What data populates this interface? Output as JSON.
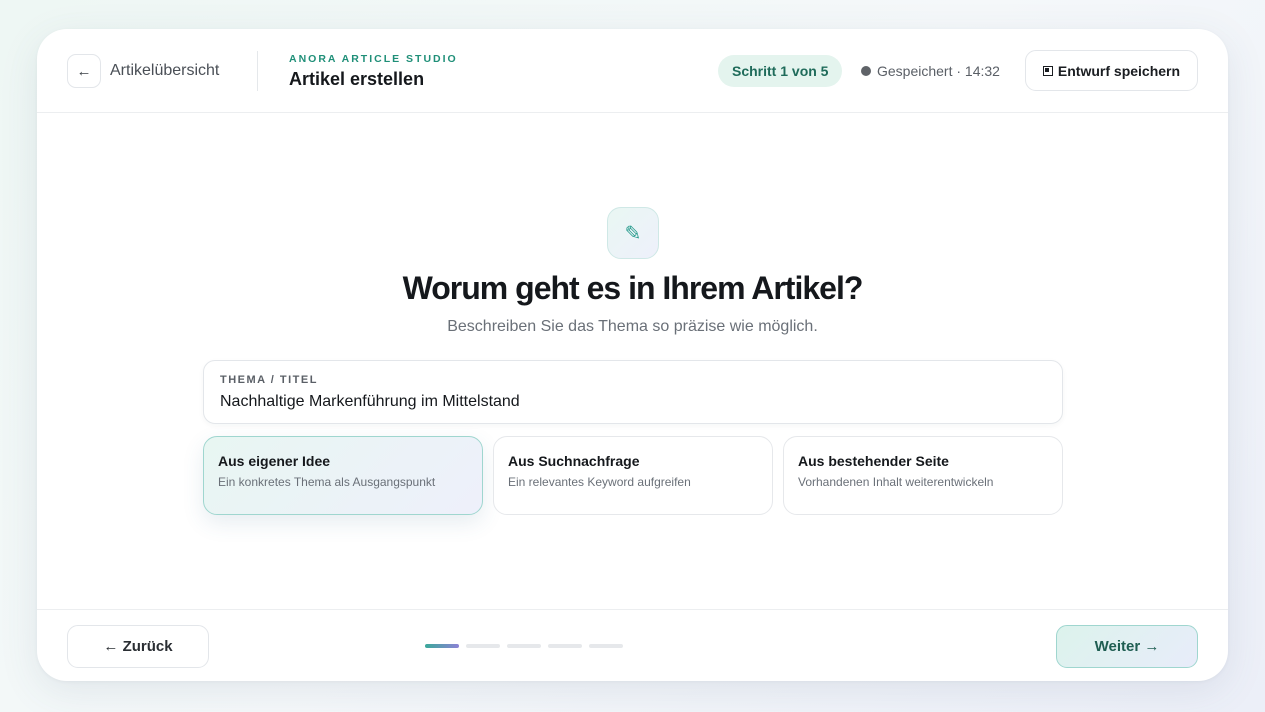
{
  "header": {
    "back_icon": "arrow-left-icon",
    "back_label": "Artikelübersicht",
    "brand": "ANORA ARTICLE STUDIO",
    "title": "Artikel erstellen",
    "step_badge": "Schritt 1 von 5",
    "save_status": "Gespeichert · 14:32",
    "draft_button": "Entwurf speichern"
  },
  "main": {
    "hero_icon": "pencil-icon",
    "hero_glyph": "✎",
    "question": "Worum geht es in Ihrem Artikel?",
    "subtitle": "Beschreiben Sie das Thema so präzise wie möglich.",
    "topic_field": {
      "label": "THEMA / TITEL",
      "value": "Nachhaltige Markenführung im Mittelstand"
    },
    "options": [
      {
        "title": "Aus eigener Idee",
        "description": "Ein konkretes Thema als Ausgangspunkt",
        "selected": true
      },
      {
        "title": "Aus Suchnachfrage",
        "description": "Ein relevantes Keyword aufgreifen",
        "selected": false
      },
      {
        "title": "Aus bestehender Seite",
        "description": "Vorhandenen Inhalt weiterentwickeln",
        "selected": false
      }
    ]
  },
  "footer": {
    "back_button": "← Zurück",
    "next_button": "Weiter →",
    "progress": {
      "current_step": 1,
      "total_steps": 5
    }
  },
  "colors": {
    "accent": "#1f8f78",
    "accent_bg": "#e4f4ee",
    "selected_border": "#9fd6cf",
    "gradient_end": "#8d82d6"
  }
}
